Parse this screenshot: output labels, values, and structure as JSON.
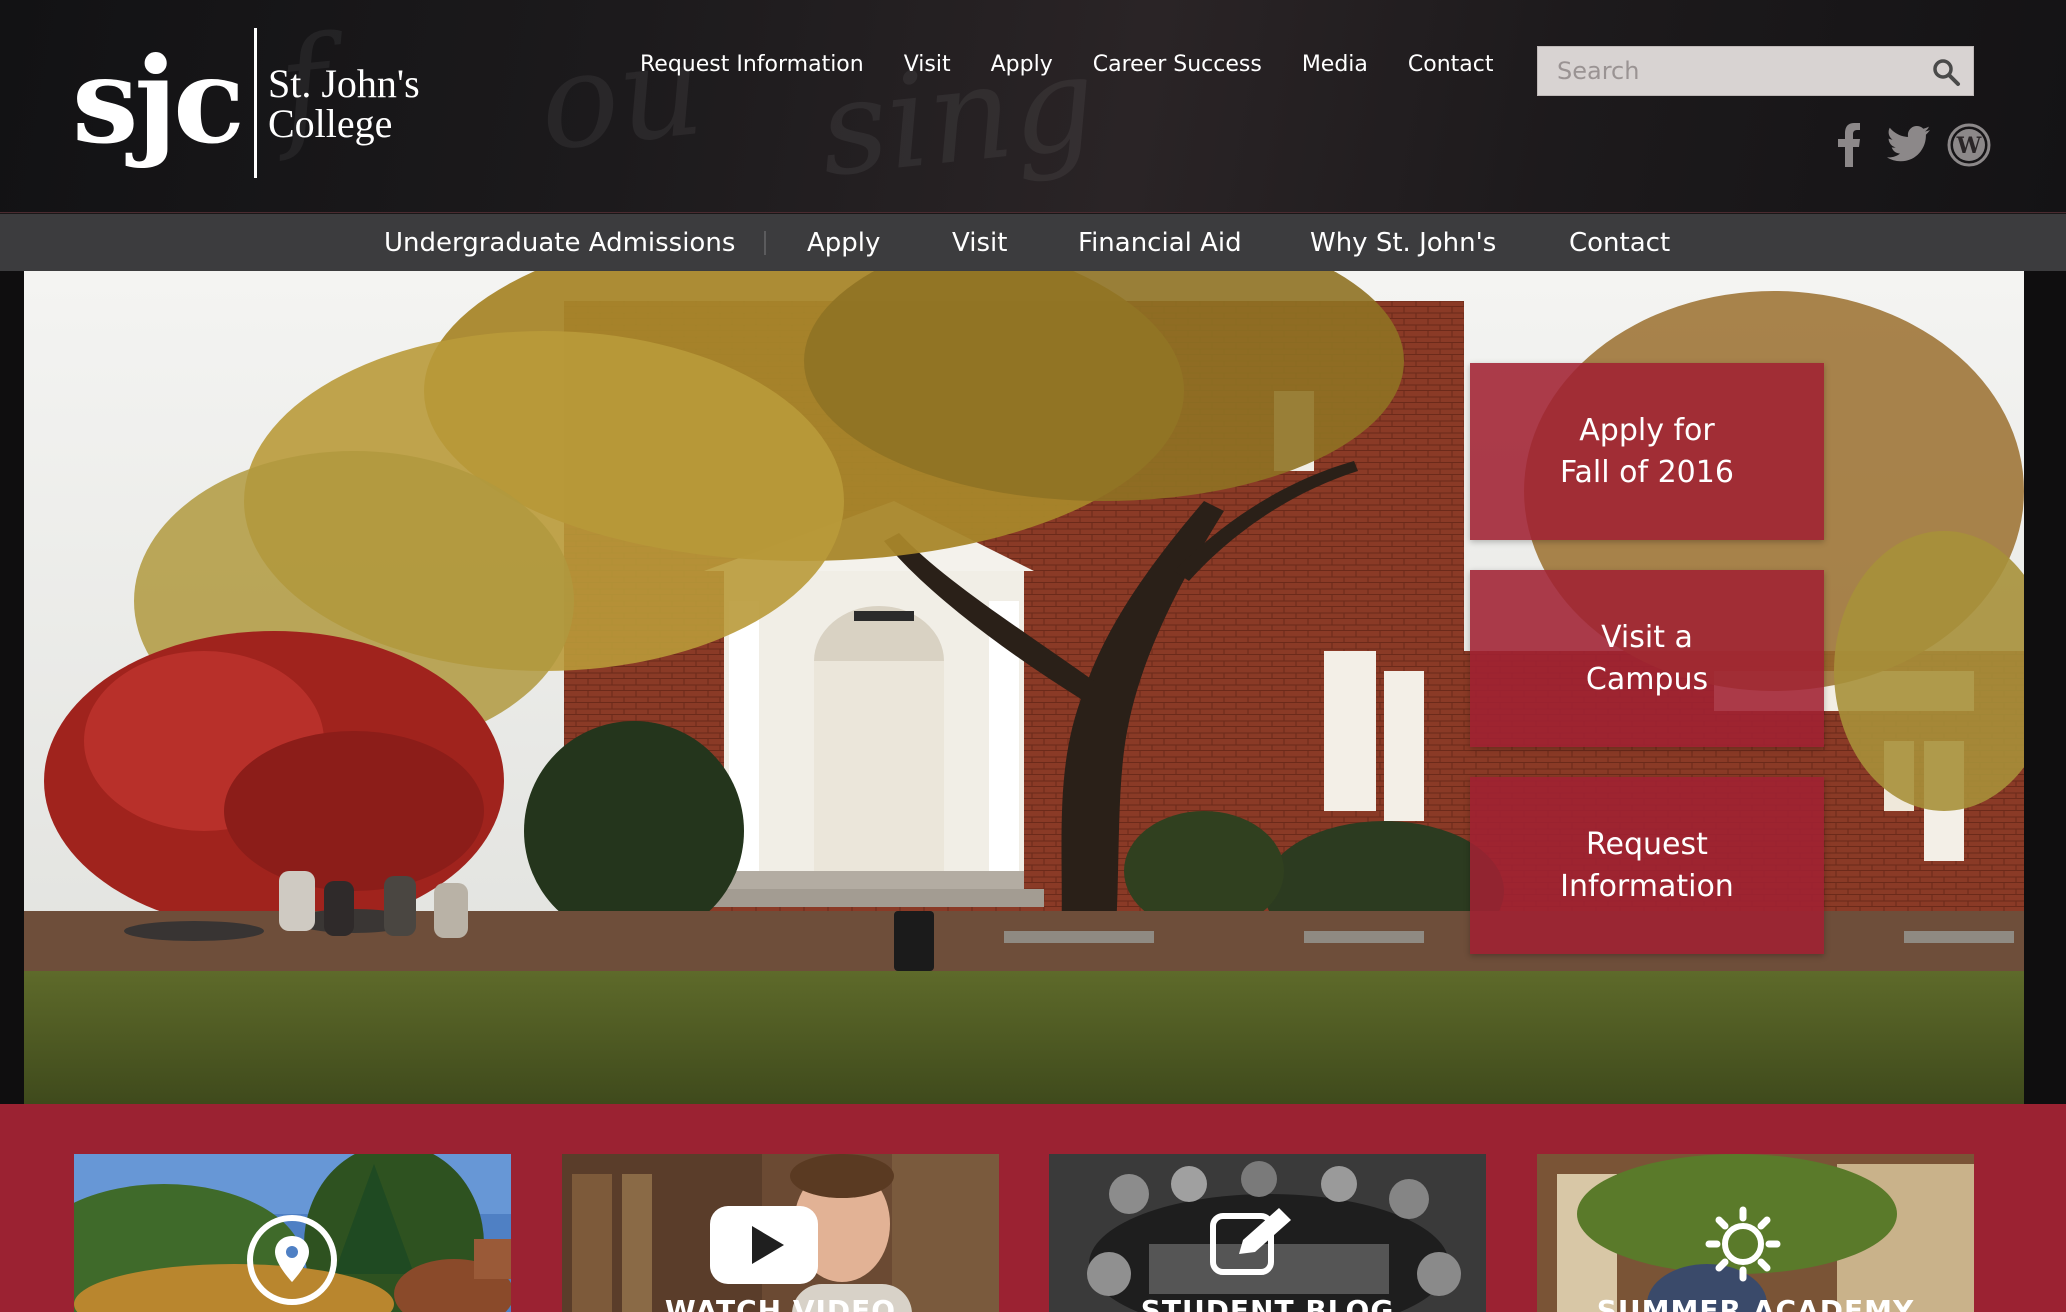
{
  "logo": {
    "mark": "sjc",
    "name_line1": "St. John's",
    "name_line2": "College"
  },
  "top_nav": [
    "Request Information",
    "Visit",
    "Apply",
    "Career Success",
    "Media",
    "Contact"
  ],
  "search": {
    "placeholder": "Search",
    "value": ""
  },
  "social": {
    "icons": [
      "facebook-icon",
      "twitter-icon",
      "wordpress-icon"
    ]
  },
  "sub_nav": [
    "Undergraduate Admissions",
    "Apply",
    "Visit",
    "Financial Aid",
    "Why St. John's",
    "Contact"
  ],
  "hero": {
    "cta": [
      {
        "label": "Apply for\nFall of 2016"
      },
      {
        "label": "Visit a\nCampus"
      },
      {
        "label": "Request\nInformation"
      }
    ]
  },
  "cards": [
    {
      "icon": "map-pin-icon",
      "label": ""
    },
    {
      "icon": "play-icon",
      "label": "WATCH VIDEO"
    },
    {
      "icon": "pencil-icon",
      "label": "STUDENT BLOG"
    },
    {
      "icon": "sun-icon",
      "label": "SUMMER ACADEMY"
    }
  ],
  "colors": {
    "brand_red": "#9b2232",
    "cta_red": "#a02132",
    "subnav_gray": "#3c3c3e"
  }
}
